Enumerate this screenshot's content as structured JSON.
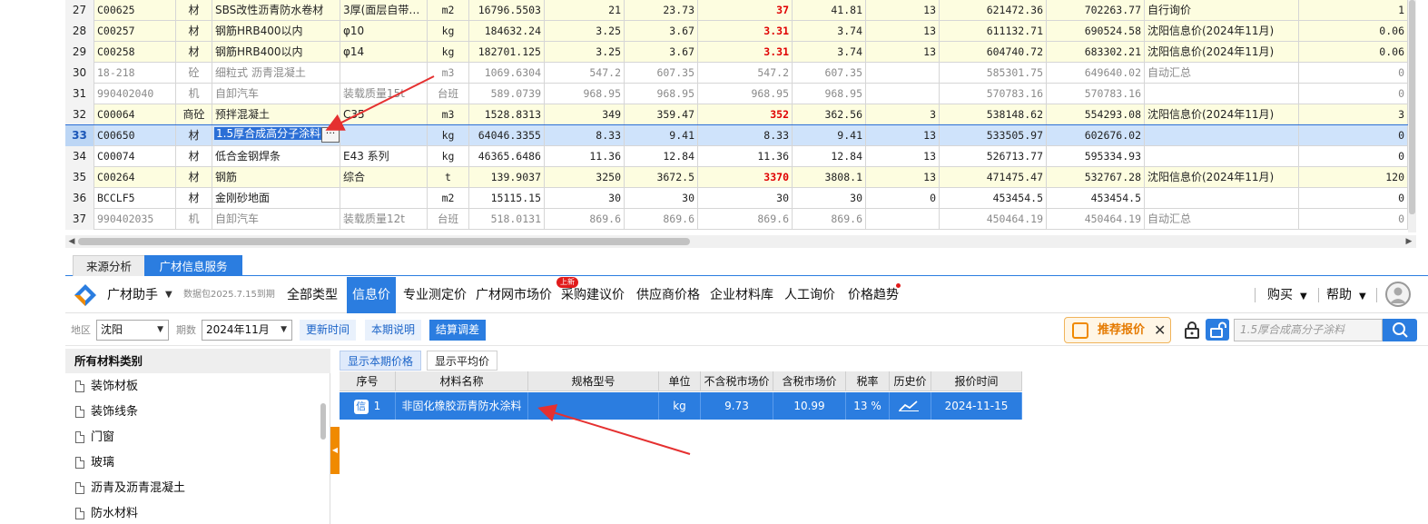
{
  "upper_grid": {
    "rows": [
      {
        "rn": "27",
        "code": "C00625",
        "type": "材",
        "name": "SBS改性沥青防水卷材",
        "spec": "3厚(面层自带…",
        "unit": "m2",
        "qty": "16796.5503",
        "p1": "21",
        "p2": "23.73",
        "p3": "37",
        "p4": "41.81",
        "tax": "13",
        "amt1": "621472.36",
        "amt2": "702263.77",
        "src": "自行询价",
        "extra": "1",
        "style": "yellow",
        "grey": false,
        "red_p3": true
      },
      {
        "rn": "28",
        "code": "C00257",
        "type": "材",
        "name": "钢筋HRB400以内",
        "spec": "φ10",
        "unit": "kg",
        "qty": "184632.24",
        "p1": "3.25",
        "p2": "3.67",
        "p3": "3.31",
        "p4": "3.74",
        "tax": "13",
        "amt1": "611132.71",
        "amt2": "690524.58",
        "src": "沈阳信息价(2024年11月)",
        "extra": "0.06",
        "style": "yellow",
        "grey": false,
        "red_p3": true
      },
      {
        "rn": "29",
        "code": "C00258",
        "type": "材",
        "name": "钢筋HRB400以内",
        "spec": "φ14",
        "unit": "kg",
        "qty": "182701.125",
        "p1": "3.25",
        "p2": "3.67",
        "p3": "3.31",
        "p4": "3.74",
        "tax": "13",
        "amt1": "604740.72",
        "amt2": "683302.21",
        "src": "沈阳信息价(2024年11月)",
        "extra": "0.06",
        "style": "yellow",
        "grey": false,
        "red_p3": true
      },
      {
        "rn": "30",
        "code": "18-218",
        "type": "砼",
        "name": "细粒式 沥青混凝土",
        "spec": "",
        "unit": "m3",
        "qty": "1069.6304",
        "p1": "547.2",
        "p2": "607.35",
        "p3": "547.2",
        "p4": "607.35",
        "tax": "",
        "amt1": "585301.75",
        "amt2": "649640.02",
        "src": "自动汇总",
        "extra": "0",
        "style": "plain",
        "grey": true,
        "red_p3": false
      },
      {
        "rn": "31",
        "code": "990402040",
        "type": "机",
        "name": "自卸汽车",
        "spec": "装载质量15t",
        "unit": "台班",
        "qty": "589.0739",
        "p1": "968.95",
        "p2": "968.95",
        "p3": "968.95",
        "p4": "968.95",
        "tax": "",
        "amt1": "570783.16",
        "amt2": "570783.16",
        "src": "",
        "extra": "0",
        "style": "plain",
        "grey": true,
        "red_p3": false
      },
      {
        "rn": "32",
        "code": "C00064",
        "type": "商砼",
        "name": "预拌混凝土",
        "spec": "C35",
        "unit": "m3",
        "qty": "1528.8313",
        "p1": "349",
        "p2": "359.47",
        "p3": "352",
        "p4": "362.56",
        "tax": "3",
        "amt1": "538148.62",
        "amt2": "554293.08",
        "src": "沈阳信息价(2024年11月)",
        "extra": "3",
        "style": "yellow",
        "grey": false,
        "red_p3": true
      },
      {
        "rn": "33",
        "code": "C00650",
        "type": "材",
        "name": "1.5厚合成高分子涂料",
        "spec": "",
        "unit": "kg",
        "qty": "64046.3355",
        "p1": "8.33",
        "p2": "9.41",
        "p3": "8.33",
        "p4": "9.41",
        "tax": "13",
        "amt1": "533505.97",
        "amt2": "602676.02",
        "src": "",
        "extra": "0",
        "style": "selected",
        "grey": false,
        "red_p3": false
      },
      {
        "rn": "34",
        "code": "C00074",
        "type": "材",
        "name": "低合金钢焊条",
        "spec": "E43 系列",
        "unit": "kg",
        "qty": "46365.6486",
        "p1": "11.36",
        "p2": "12.84",
        "p3": "11.36",
        "p4": "12.84",
        "tax": "13",
        "amt1": "526713.77",
        "amt2": "595334.93",
        "src": "",
        "extra": "0",
        "style": "plain",
        "grey": false,
        "red_p3": false
      },
      {
        "rn": "35",
        "code": "C00264",
        "type": "材",
        "name": "钢筋",
        "spec": "综合",
        "unit": "t",
        "qty": "139.9037",
        "p1": "3250",
        "p2": "3672.5",
        "p3": "3370",
        "p4": "3808.1",
        "tax": "13",
        "amt1": "471475.47",
        "amt2": "532767.28",
        "src": "沈阳信息价(2024年11月)",
        "extra": "120",
        "style": "yellow",
        "grey": false,
        "red_p3": true
      },
      {
        "rn": "36",
        "code": "BCCLF5",
        "type": "材",
        "name": "金刚砂地面",
        "spec": "",
        "unit": "m2",
        "qty": "15115.15",
        "p1": "30",
        "p2": "30",
        "p3": "30",
        "p4": "30",
        "tax": "0",
        "amt1": "453454.5",
        "amt2": "453454.5",
        "src": "",
        "extra": "0",
        "style": "plain",
        "grey": false,
        "red_p3": false
      },
      {
        "rn": "37",
        "code": "990402035",
        "type": "机",
        "name": "自卸汽车",
        "spec": "装载质量12t",
        "unit": "台班",
        "qty": "518.0131",
        "p1": "869.6",
        "p2": "869.6",
        "p3": "869.6",
        "p4": "869.6",
        "tax": "",
        "amt1": "450464.19",
        "amt2": "450464.19",
        "src": "自动汇总",
        "extra": "0",
        "style": "plain",
        "grey": true,
        "red_p3": false
      }
    ],
    "edit_button": "···"
  },
  "bottom_tabs": {
    "source_analysis": "来源分析",
    "gcw_service": "广材信息服务"
  },
  "toolbar": {
    "brand": "广材助手",
    "package": "数据包2025.7.15到期",
    "nav": [
      "全部类型",
      "信息价",
      "专业测定价",
      "广材网市场价",
      "采购建议价",
      "供应商价格",
      "企业材料库",
      "人工询价",
      "价格趋势"
    ],
    "new_badge": "上新",
    "buy": "购买",
    "help": "帮助"
  },
  "filter": {
    "region_label": "地区",
    "region_value": "沈阳",
    "period_label": "期数",
    "period_value": "2024年11月",
    "update_time": "更新时间",
    "period_note": "本期说明",
    "settlement": "结算调差",
    "recommend": "推荐报价",
    "search_placeholder": "1.5厚合成高分子涂料"
  },
  "categories": {
    "header": "所有材料类别",
    "items": [
      "装饰材板",
      "装饰线条",
      "门窗",
      "玻璃",
      "沥青及沥青混凝土",
      "防水材料"
    ]
  },
  "price_tabs": {
    "current": "显示本期价格",
    "average": "显示平均价"
  },
  "price_table": {
    "headers": [
      "序号",
      "材料名称",
      "规格型号",
      "单位",
      "不含税市场价",
      "含税市场价",
      "税率",
      "历史价",
      "报价时间"
    ],
    "rows": [
      {
        "badge": "信",
        "no": "1",
        "name": "非固化橡胶沥青防水涂料",
        "spec": "",
        "unit": "kg",
        "price_ex": "9.73",
        "price_in": "10.99",
        "tax": "13 %",
        "date": "2024-11-15"
      }
    ]
  },
  "colors": {
    "accent": "#2b7de0",
    "highlight_row": "#fdfde0",
    "red_price": "#e00000",
    "arrow": "#e53030",
    "orange": "#f08a00"
  }
}
